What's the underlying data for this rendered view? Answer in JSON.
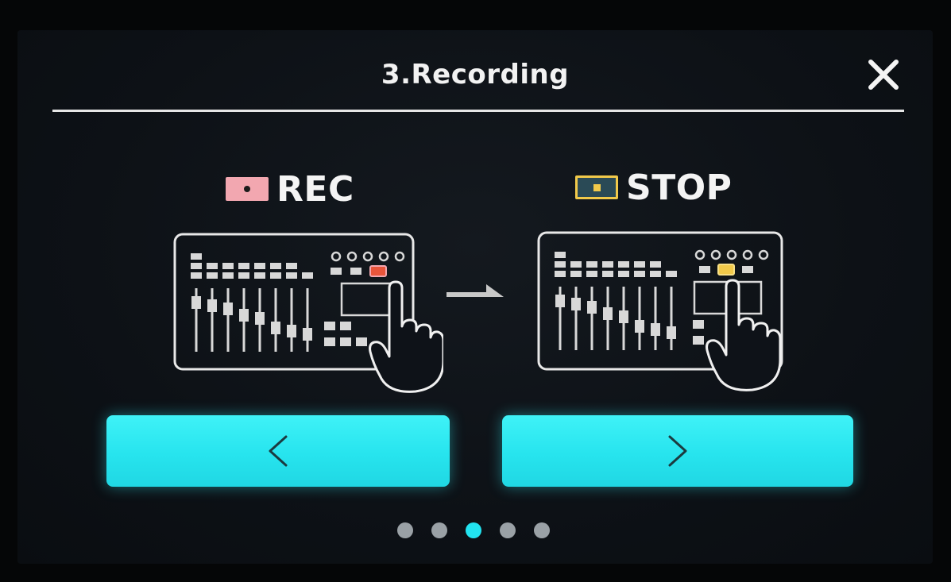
{
  "dialog": {
    "title": "3.Recording",
    "close_icon": "close-icon"
  },
  "steps": [
    {
      "label": "REC",
      "badge_icon": "rec-indicator-icon",
      "badge_color": "#f2a7b0",
      "highlighted_button_color": "#e8553b"
    },
    {
      "label": "STOP",
      "badge_icon": "stop-indicator-icon",
      "badge_color": "#f1c94a",
      "highlighted_button_color": "#f1c94a"
    }
  ],
  "transition_icon": "arrow-right-icon",
  "navigation": {
    "prev_icon": "chevron-left-icon",
    "next_icon": "chevron-right-icon",
    "button_color": "#27e4ee"
  },
  "pager": {
    "total_pages": 5,
    "current_page": 3,
    "active_color": "#22e3f0",
    "inactive_color": "#9aa1a6"
  }
}
